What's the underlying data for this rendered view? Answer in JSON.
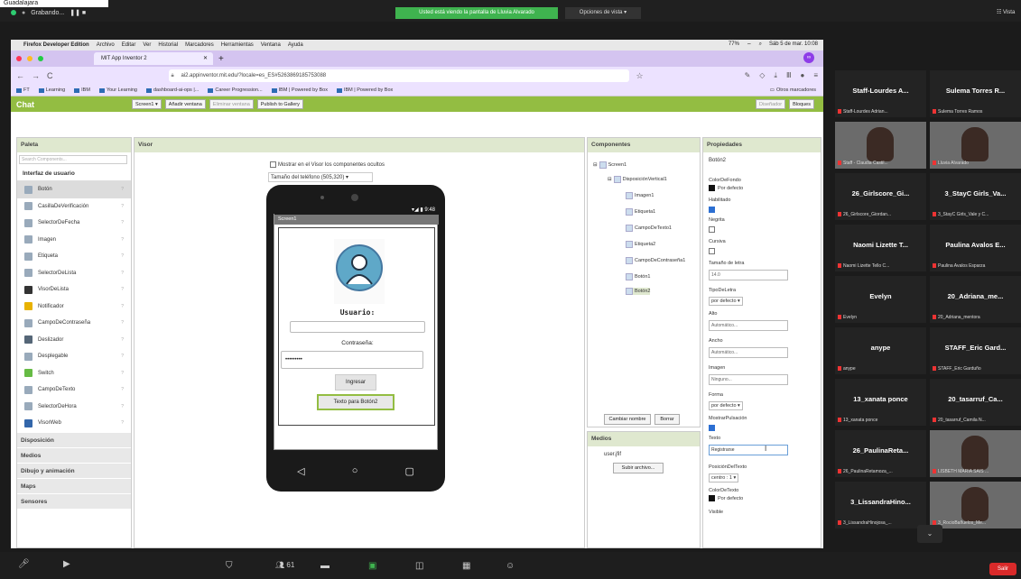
{
  "zoom": {
    "subtitle": "Guadalajara",
    "recording": "Grabando...",
    "share_banner": "Usted está viendo la pantalla de Lluvia Alvarado",
    "view_options": "Opciones de vista",
    "view_label": "Vista",
    "toolbar": [
      "Detener vídeo",
      "Seguridad",
      "Participantes",
      "Chat",
      "Compartir pantalla",
      "Reacciones"
    ],
    "leave": "Salir",
    "participants_count": "61"
  },
  "mac": {
    "app": "Firefox Developer Edition",
    "menus": [
      "Archivo",
      "Editar",
      "Ver",
      "Historial",
      "Marcadores",
      "Herramientas",
      "Ventana",
      "Ayuda"
    ],
    "battery": "77%",
    "datetime": "Sáb 5 de mar. 10:08"
  },
  "browser": {
    "tab_title": "MIT App Inventor 2",
    "url": "ai2.appinventor.mit.edu/?locale=es_ES#5263869185753088",
    "bookmarks": [
      "FT",
      "Learning",
      "IBM",
      "Your Learning",
      "dashboard-ai-ops |...",
      "Career Progression...",
      "IBM | Powered by Box",
      "IBM | Powered by Box"
    ],
    "other_bookmarks": "Otros marcadores"
  },
  "ai": {
    "title": "Chat",
    "toolbar": [
      "Screen1 ▾",
      "Añadir ventana",
      "Eliminar ventana",
      "Publish to Gallery"
    ],
    "mode_buttons": [
      "Diseñador",
      "Bloques"
    ],
    "palette_title": "Paleta",
    "search_placeholder": "Search Components...",
    "palette_category": "Interfaz de usuario",
    "palette_items": [
      "Botón",
      "CasillaDeVerificación",
      "SelectorDeFecha",
      "Imagen",
      "Etiqueta",
      "SelectorDeLista",
      "VisorDeLista",
      "Notificador",
      "CampoDeContraseña",
      "Deslizador",
      "Desplegable",
      "Switch",
      "CampoDeTexto",
      "SelectorDeHora",
      "VisorWeb"
    ],
    "palette_more": [
      "Disposición",
      "Medios",
      "Dibujo y animación",
      "Maps",
      "Sensores"
    ],
    "viewer_title": "Visor",
    "viewer_check": "Mostrar en el Visor los componentes ocultos",
    "viewer_size": "Tamaño del teléfono (505,320)",
    "phone": {
      "time": "9:48",
      "screen_title": "Screen1",
      "user_label": "Usuario:",
      "pass_label": "Contraseña:",
      "pass_value": "•••••••••",
      "btn1": "Ingresar",
      "btn2": "Texto para Botón2"
    },
    "components_title": "Componentes",
    "components": [
      "Screen1",
      "DisposiciónVertical1",
      "Imagen1",
      "Etiqueta1",
      "CampoDeTexto1",
      "Etiqueta2",
      "CampoDeContraseña1",
      "Botón1",
      "Botón2"
    ],
    "rename": "Cambiar nombre",
    "delete": "Borrar",
    "media_title": "Medios",
    "media_file": "user.jfif",
    "upload": "Subir archivo...",
    "props_title": "Propiedades",
    "props_selected": "Botón2",
    "props": {
      "bgcolor_label": "ColorDeFondo",
      "bgcolor_value": "Por defecto",
      "enabled_label": "Habilitado",
      "bold_label": "Negrita",
      "italic_label": "Cursiva",
      "fontsize_label": "Tamaño de letra",
      "fontsize_value": "14.0",
      "fonttype_label": "TipoDeLetra",
      "fonttype_value": "por defecto ▾",
      "height_label": "Alto",
      "height_value": "Automático...",
      "width_label": "Ancho",
      "width_value": "Automático...",
      "image_label": "Imagen",
      "image_value": "Ninguno...",
      "shape_label": "Forma",
      "shape_value": "por defecto ▾",
      "feedback_label": "MostrarPulsación",
      "text_label": "Texto",
      "text_value": "Registrarse",
      "textpos_label": "PosiciónDelTexto",
      "textpos_value": "centro : 1 ▾",
      "textcolor_label": "ColorDeTexto",
      "textcolor_value": "Por defecto",
      "visible_label": "Visible"
    }
  },
  "gallery": [
    {
      "name": "Staff-Lourdes A...",
      "sub": "Staff-Lourdes Adrian..."
    },
    {
      "name": "Sulema Torres R...",
      "sub": "Sulema Torres Ramos"
    },
    {
      "name": "",
      "sub": "Staff - Claudia Castil..."
    },
    {
      "name": "",
      "sub": "Lluvia Alvarado"
    },
    {
      "name": "26_Girlscore_Gi...",
      "sub": "26_Girlscore_Giordan..."
    },
    {
      "name": "3_StayC Girls_Va...",
      "sub": "3_StayC Girls_Vale y C..."
    },
    {
      "name": "Naomi Lizette T...",
      "sub": "Naomi Lizette Tello C..."
    },
    {
      "name": "Paulina Avalos E...",
      "sub": "Paulina Avalos Esparza"
    },
    {
      "name": "Evelyn",
      "sub": "Evelyn"
    },
    {
      "name": "20_Adriana_me...",
      "sub": "20_Adriana_mentora"
    },
    {
      "name": "anype",
      "sub": "anype"
    },
    {
      "name": "STAFF_Eric Gard...",
      "sub": "STAFF_Eric Garduño"
    },
    {
      "name": "13_xanata ponce",
      "sub": "13_xanata ponce"
    },
    {
      "name": "20_tasarruf_Ca...",
      "sub": "20_tasarruf_Camila N..."
    },
    {
      "name": "26_PaulinaReta...",
      "sub": "26_PaulinaRetamoza_..."
    },
    {
      "name": "",
      "sub": "LISBETH MARIA SAIS ..."
    },
    {
      "name": "3_LissandraHino...",
      "sub": "3_LissandraHinojosa_..."
    },
    {
      "name": "",
      "sub": "3_RocioBañuelos_Me..."
    }
  ]
}
